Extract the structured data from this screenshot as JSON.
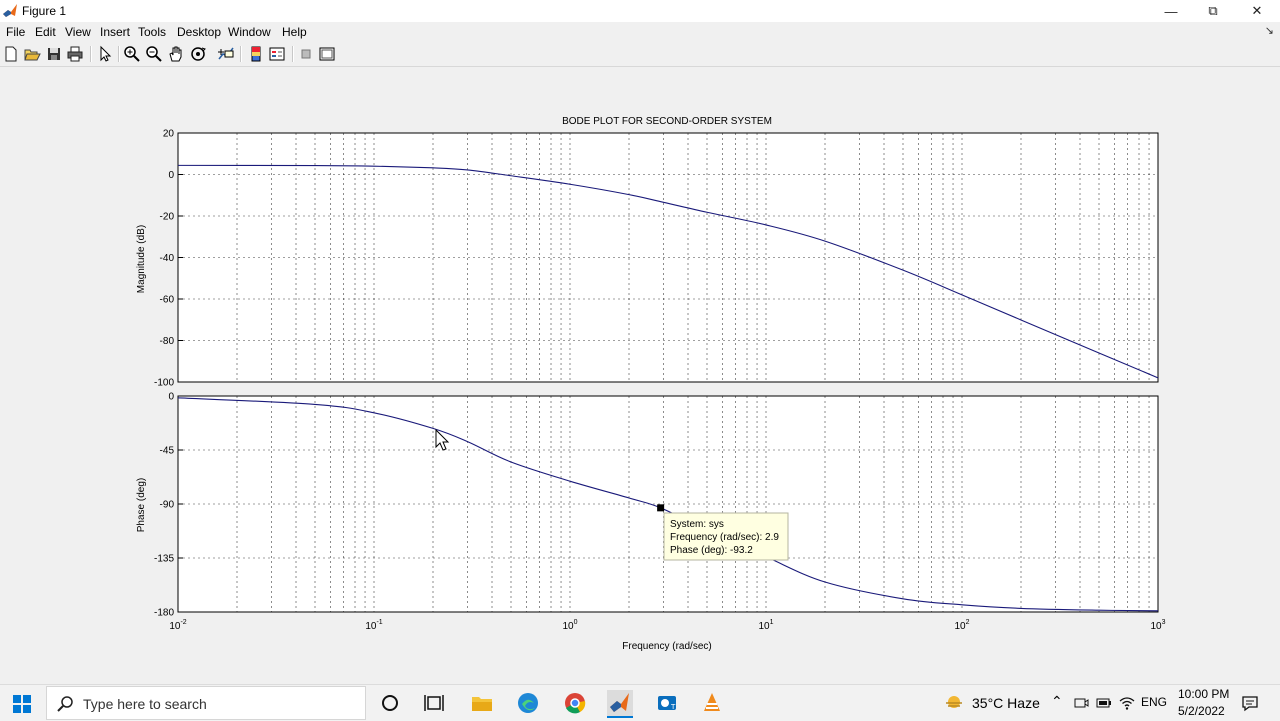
{
  "window": {
    "title": "Figure 1"
  },
  "menu": [
    "File",
    "Edit",
    "View",
    "Insert",
    "Tools",
    "Desktop",
    "Window",
    "Help"
  ],
  "chart_data": [
    {
      "type": "line",
      "title": "BODE PLOT FOR SECOND-ORDER SYSTEM",
      "ylabel": "Magnitude (dB)",
      "xlabel": "",
      "xscale": "log",
      "xlim": [
        0.01,
        1000
      ],
      "ylim": [
        -100,
        20
      ],
      "yticks": [
        "20",
        "0",
        "-20",
        "-40",
        "-60",
        "-80",
        "-100"
      ],
      "grid": true,
      "x": [
        0.01,
        0.05,
        0.1,
        0.2,
        0.3,
        0.5,
        1,
        2,
        3,
        5,
        10,
        20,
        50,
        100,
        200,
        500,
        1000
      ],
      "values": [
        4.4,
        4.3,
        4.0,
        3.2,
        2.2,
        -0.6,
        -4.7,
        -9.7,
        -13.4,
        -18.2,
        -24.3,
        -32.1,
        -46.1,
        -58.0,
        -70.1,
        -86.0,
        -98.0
      ]
    },
    {
      "type": "line",
      "ylabel": "Phase (deg)",
      "xlabel": "Frequency  (rad/sec)",
      "xscale": "log",
      "xlim": [
        0.01,
        1000
      ],
      "ylim": [
        -180,
        0
      ],
      "yticks": [
        "0",
        "-45",
        "-90",
        "-135",
        "-180"
      ],
      "xticks": [
        {
          "base": "10",
          "exp": "-2"
        },
        {
          "base": "10",
          "exp": "-1"
        },
        {
          "base": "10",
          "exp": "0"
        },
        {
          "base": "10",
          "exp": "1"
        },
        {
          "base": "10",
          "exp": "2"
        },
        {
          "base": "10",
          "exp": "3"
        }
      ],
      "grid": true,
      "x": [
        0.01,
        0.05,
        0.1,
        0.2,
        0.3,
        0.5,
        1,
        2,
        2.9,
        5,
        10,
        20,
        50,
        100,
        200,
        500,
        1000
      ],
      "values": [
        -1.5,
        -7,
        -14,
        -27,
        -38,
        -55,
        -71,
        -85,
        -93.2,
        -112,
        -134,
        -155,
        -169,
        -174,
        -177,
        -178.5,
        -179
      ]
    }
  ],
  "datatip": {
    "line1": "System: sys",
    "line2": "Frequency (rad/sec): 2.9",
    "line3": "Phase (deg): -93.2",
    "x": 2.9,
    "y": -93.2
  },
  "taskbar": {
    "search_placeholder": "Type here to search",
    "weather": "35°C  Haze",
    "lang": "ENG",
    "time": "10:00 PM",
    "date": "5/2/2022"
  },
  "colors": {
    "curve": "#1a1a7a",
    "grid": "#000000",
    "tip_bg": "#ffffe1",
    "matlab": "#e86a1a"
  }
}
